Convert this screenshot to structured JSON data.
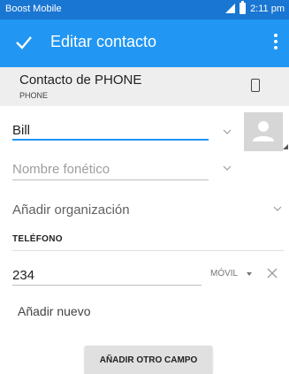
{
  "status_bar": {
    "carrier": "Boost Mobile",
    "time": "2:11 pm"
  },
  "app_bar": {
    "title": "Editar contacto"
  },
  "account": {
    "name": "Contacto de PHONE",
    "type": "PHONE"
  },
  "form": {
    "name_value": "Bill",
    "phonetic_placeholder": "Nombre fonético",
    "organization_label": "Añadir organización",
    "phone_section_label": "TELÉFONO",
    "phone_value": "234",
    "phone_type": "MÓVIL",
    "add_new_label": "Añadir nuevo",
    "add_field_button": "AÑADIR OTRO CAMPO"
  },
  "colors": {
    "status_bar": "#1976d2",
    "app_bar": "#2196f3",
    "accent": "#2196f3"
  }
}
